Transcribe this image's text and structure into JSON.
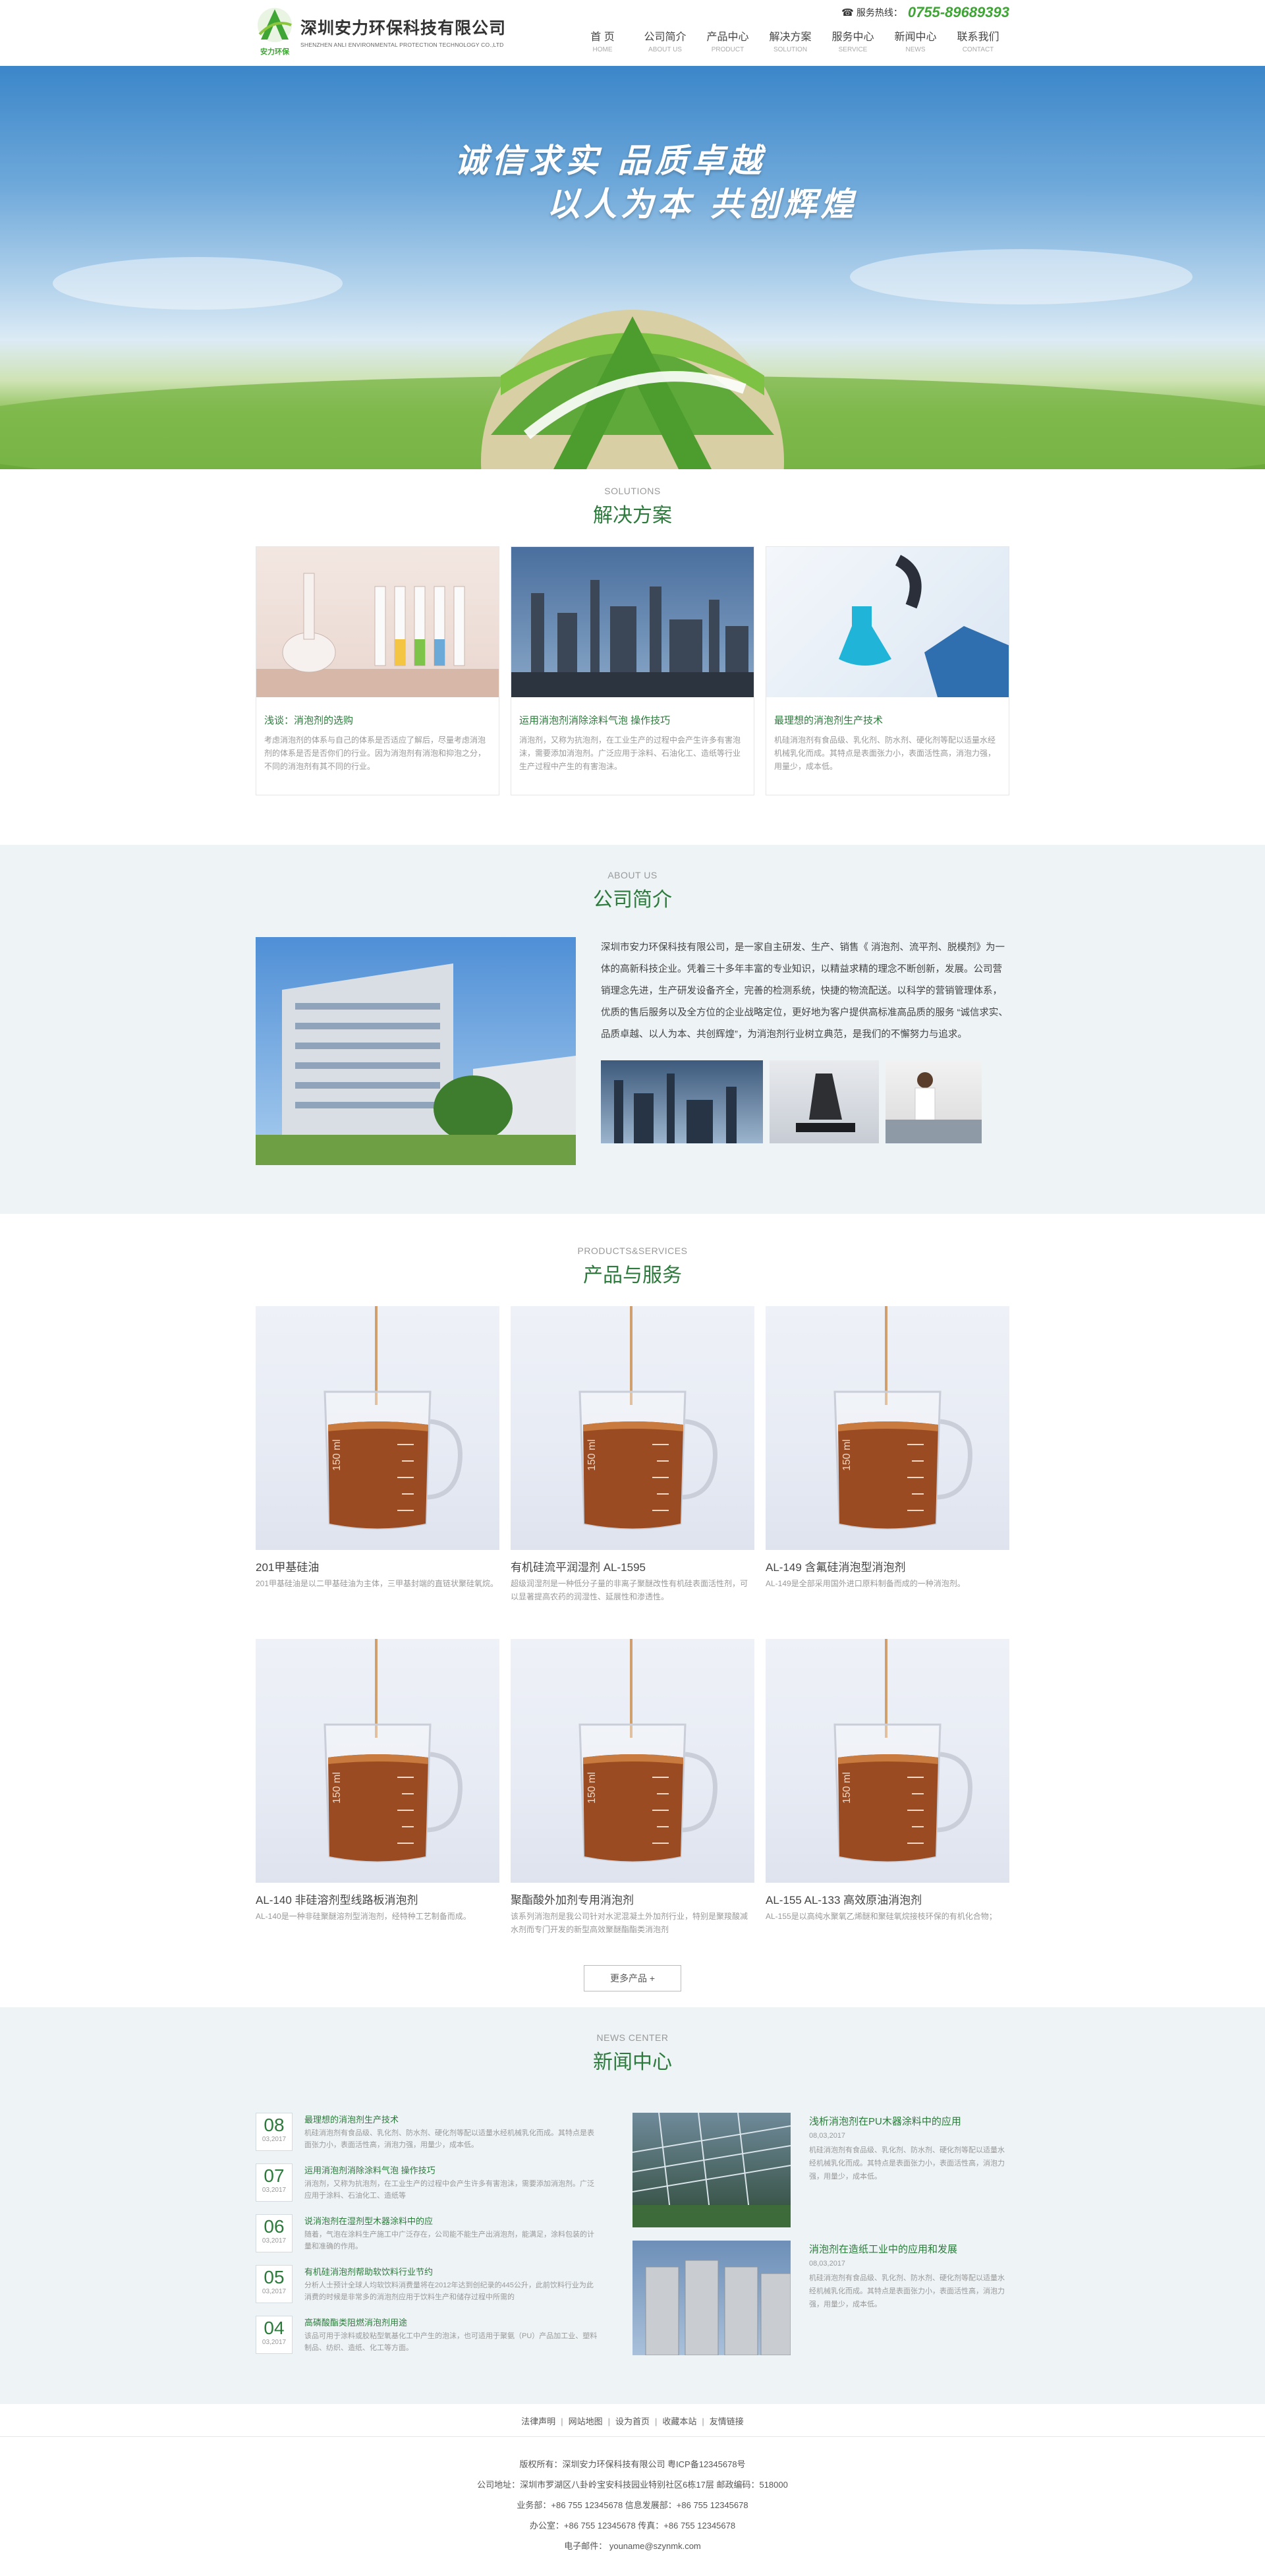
{
  "colors": {
    "brand_green": "#2d7a3d",
    "accent_green": "#3fa535",
    "bg_light": "#eef3f6"
  },
  "header": {
    "logo_small_text": "安力环保",
    "company_cn": "深圳安力环保科技有限公司",
    "company_en": "SHENZHEN ANLI ENVIRONMENTAL PROTECTION TECHNOLOGY CO.,LTD",
    "hotline_label": "服务热线：",
    "hotline_icon": "phone-icon",
    "hotline_number": "0755-89689393",
    "nav": [
      {
        "cn": "首 页",
        "en": "HOME"
      },
      {
        "cn": "公司简介",
        "en": "ABOUT US"
      },
      {
        "cn": "产品中心",
        "en": "PRODUCT"
      },
      {
        "cn": "解决方案",
        "en": "SOLUTION"
      },
      {
        "cn": "服务中心",
        "en": "SERVICE"
      },
      {
        "cn": "新闻中心",
        "en": "NEWS"
      },
      {
        "cn": "联系我们",
        "en": "CONTACT"
      }
    ]
  },
  "banner": {
    "slogan_line1": "诚信求实 品质卓越",
    "slogan_line2": "以人为本 共创辉煌"
  },
  "solutions": {
    "en": "SOLUTIONS",
    "cn": "解决方案",
    "items": [
      {
        "title": "浅谈：消泡剂的选购",
        "desc": "考虑消泡剂的体系与自己的体系是否适应了解后，尽量考虑消泡剂的体系是否是否你们的行业。因为消泡剂有消泡和抑泡之分，不同的消泡剂有其不同的行业。"
      },
      {
        "title": "运用消泡剂消除涂料气泡 操作技巧",
        "desc": "消泡剂，又称为抗泡剂，在工业生产的过程中会产生许多有害泡沫，需要添加消泡剂。广泛应用于涂料、石油化工、造纸等行业生产过程中产生的有害泡沫。"
      },
      {
        "title": "最理想的消泡剂生产技术",
        "desc": "机硅消泡剂有食品级、乳化剂、防水剂、硬化剂等配以适量水经机械乳化而成。其特点是表面张力小，表面活性高，消泡力强，用量少，成本低。"
      }
    ]
  },
  "about": {
    "en": "ABOUT US",
    "cn": "公司简介",
    "text": "深圳市安力环保科技有限公司，是一家自主研发、生产、销售《 消泡剂、流平剂、脱模剂》为一体的高新科技企业。凭着三十多年丰富的专业知识，以精益求精的理念不断创新，发展。公司营销理念先进，生产研发设备齐全，完善的检测系统，快捷的物流配送。以科学的营销管理体系，优质的售后服务以及全方位的企业战略定位，更好地为客户提供高标准高品质的服务 “诚信求实、品质卓越、以人为本、共创辉煌”，为消泡剂行业树立典范，是我们的不懈努力与追求。"
  },
  "products": {
    "en": "PRODUCTS&SERVICES",
    "cn": "产品与服务",
    "beaker_label": "150 ml",
    "items": [
      {
        "name": "201甲基硅油",
        "desc": "201甲基硅油是以二甲基硅油为主体，三甲基封端的直链状聚硅氧烷。"
      },
      {
        "name": "有机硅流平润湿剂 AL-1595",
        "desc": "超级润湿剂是一种低分子量的非离子聚醚改性有机硅表面活性剂，可以显著提高农药的润湿性、延展性和渗透性。"
      },
      {
        "name": "AL-149 含氟硅消泡型消泡剂",
        "desc": "AL-149是全部采用国外进口原料制备而成的一种消泡剂。"
      },
      {
        "name": "AL-140 非硅溶剂型线路板消泡剂",
        "desc": "AL-140是一种非硅聚醚溶剂型消泡剂，经特种工艺制备而成。"
      },
      {
        "name": "聚酯酸外加剂专用消泡剂",
        "desc": "该系列消泡剂是我公司针对水泥混凝土外加剂行业，特别是聚羧酸减水剂而专门开发的新型高效聚醚酯酯类消泡剂"
      },
      {
        "name": "AL-155 AL-133 高效原油消泡剂",
        "desc": "AL-155是以高纯水聚氧乙烯醚和聚硅氧烷接枝环保的有机化合物；"
      }
    ],
    "more_label": "更多产品 +"
  },
  "news": {
    "en": "NEWS CENTER",
    "cn": "新闻中心",
    "list": [
      {
        "day": "08",
        "ym": "03,2017",
        "title": "最理想的消泡剂生产技术",
        "desc": "机硅消泡剂有食品级、乳化剂、防水剂、硬化剂等配以适量水经机械乳化而成。其特点是表面张力小，表面活性高，消泡力强，用量少，成本低。"
      },
      {
        "day": "07",
        "ym": "03,2017",
        "title": "运用消泡剂消除涂料气泡 操作技巧",
        "desc": "消泡剂，又称为抗泡剂，在工业生产的过程中会产生许多有害泡沫，需要添加消泡剂。广泛应用于涂料、石油化工、造纸等"
      },
      {
        "day": "06",
        "ym": "03,2017",
        "title": "说消泡剂在湿剂型木器涂料中的应",
        "desc": "随着，气泡在涂料生产施工中广泛存在，公司能不能生产出消泡剂，能满足，涂料包装的计量和准确的作用。"
      },
      {
        "day": "05",
        "ym": "03,2017",
        "title": "有机硅消泡剂帮助软饮料行业节约",
        "desc": "分析人士预计全球人均软饮料消费量将在2012年达到创纪录的445公升，此前饮料行业为此消费的时候是非常多的消泡剂应用于饮料生产和储存过程中所需的"
      },
      {
        "day": "04",
        "ym": "03,2017",
        "title": "高磷酸酯类阻燃消泡剂用途",
        "desc": "该品可用于涂料或胶粘型氧基化工中产生的泡沫，也可适用于聚氨（PU）产品加工业、塑料制品、纺织、造纸、化工等方面。"
      }
    ],
    "featured": [
      {
        "title": "浅析消泡剂在PU木器涂料中的应用",
        "date": "08,03,2017",
        "desc": "机硅消泡剂有食品级、乳化剂、防水剂、硬化剂等配以适量水经机械乳化而成。其特点是表面张力小，表面活性高，消泡力强，用量少，成本低。"
      },
      {
        "title": "消泡剂在造纸工业中的应用和发展",
        "date": "08,03,2017",
        "desc": "机硅消泡剂有食品级、乳化剂、防水剂、硬化剂等配以适量水经机械乳化而成。其特点是表面张力小，表面活性高，消泡力强，用量少，成本低。"
      }
    ]
  },
  "footer": {
    "links": [
      "法律声明",
      "网站地图",
      "设为首页",
      "收藏本站",
      "友情链接"
    ],
    "lines": [
      "版权所有：深圳安力环保科技有限公司 粤ICP备12345678号",
      "公司地址：深圳市罗湖区八卦岭宝安科技园业特别社区6栋17层  邮政编码：518000",
      "业务部：+86 755 12345678 信息发展部：+86 755 12345678",
      "办公室：+86 755 12345678 传真：+86 755 12345678",
      "电子邮件： youname@szynmk.com"
    ]
  }
}
